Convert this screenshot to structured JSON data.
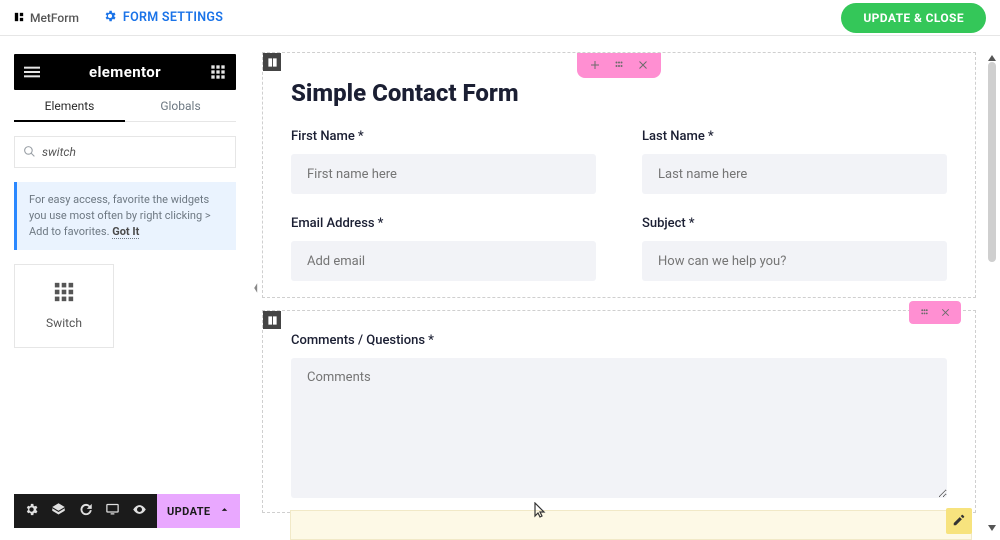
{
  "colors": {
    "accent_blue": "#1a73e8",
    "accent_green": "#34c759",
    "accent_pink": "#ff8fd2"
  },
  "topbar": {
    "brand": "MetForm",
    "settings_link": "FORM SETTINGS",
    "update_close": "UPDATE & CLOSE"
  },
  "sidebar": {
    "brand": "elementor",
    "tabs": {
      "elements": "Elements",
      "globals": "Globals",
      "active": "elements"
    },
    "search": {
      "value": "switch"
    },
    "tip_text": "For easy access, favorite the widgets you use most often by right clicking > Add to favorites.",
    "tip_cta": "Got It",
    "widget": {
      "name": "Switch"
    },
    "footer": {
      "icons": [
        "settings-icon",
        "layers-icon",
        "history-icon",
        "responsive-icon",
        "preview-icon"
      ],
      "update_label": "UPDATE"
    }
  },
  "canvas": {
    "section1": {
      "title": "Simple Contact Form",
      "fields": {
        "first_name": {
          "label": "First Name",
          "placeholder": "First name here",
          "required": true
        },
        "last_name": {
          "label": "Last Name",
          "placeholder": "Last name here",
          "required": true
        },
        "email": {
          "label": "Email Address",
          "placeholder": "Add email",
          "required": true
        },
        "subject": {
          "label": "Subject",
          "placeholder": "How can we help you?",
          "required": true
        }
      }
    },
    "section2": {
      "comments": {
        "label": "Comments / Questions",
        "placeholder": "Comments",
        "required": true
      }
    }
  }
}
